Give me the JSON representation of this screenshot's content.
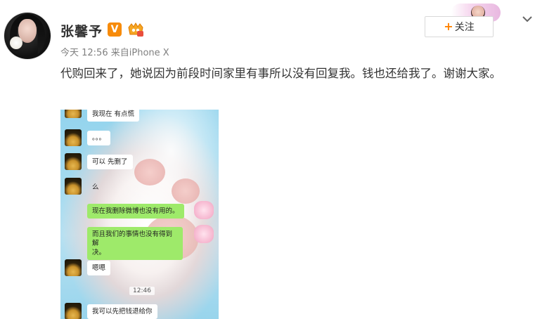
{
  "post": {
    "username": "张馨予",
    "verified_badge": "V",
    "member_icon": "vip-member-icon",
    "meta": {
      "time": "今天 12:56",
      "source_prefix": "来自",
      "source_device": "iPhone X"
    },
    "content": "代购回来了，她说因为前段时间家里有事所以没有回复我。钱也还给我了。谢谢大家。",
    "follow_button": {
      "plus": "+",
      "label": "关注"
    },
    "menu_icon": "chevron-down-icon",
    "colors": {
      "accent": "#ff8200",
      "verified": "#f78b0a",
      "meta_text": "#808080",
      "body_text": "#333333",
      "chat_green": "#9eea6a"
    }
  },
  "chat_screenshot": {
    "messages": [
      {
        "side": "left",
        "text": "我现在 有点慌"
      },
      {
        "side": "left",
        "text": "。。。"
      },
      {
        "side": "left",
        "text": "可以 先删了"
      },
      {
        "side": "left",
        "text": "么"
      },
      {
        "side": "right",
        "text": "现在我删除微博也没有用的。"
      },
      {
        "side": "right",
        "text_line1": "而且我们的事情也没有得到解",
        "text_line2": "决。"
      },
      {
        "side": "left",
        "text": "嗯嗯"
      },
      {
        "side": "left",
        "text": "我可以先把钱退给你"
      }
    ],
    "timestamp": "12:46"
  }
}
